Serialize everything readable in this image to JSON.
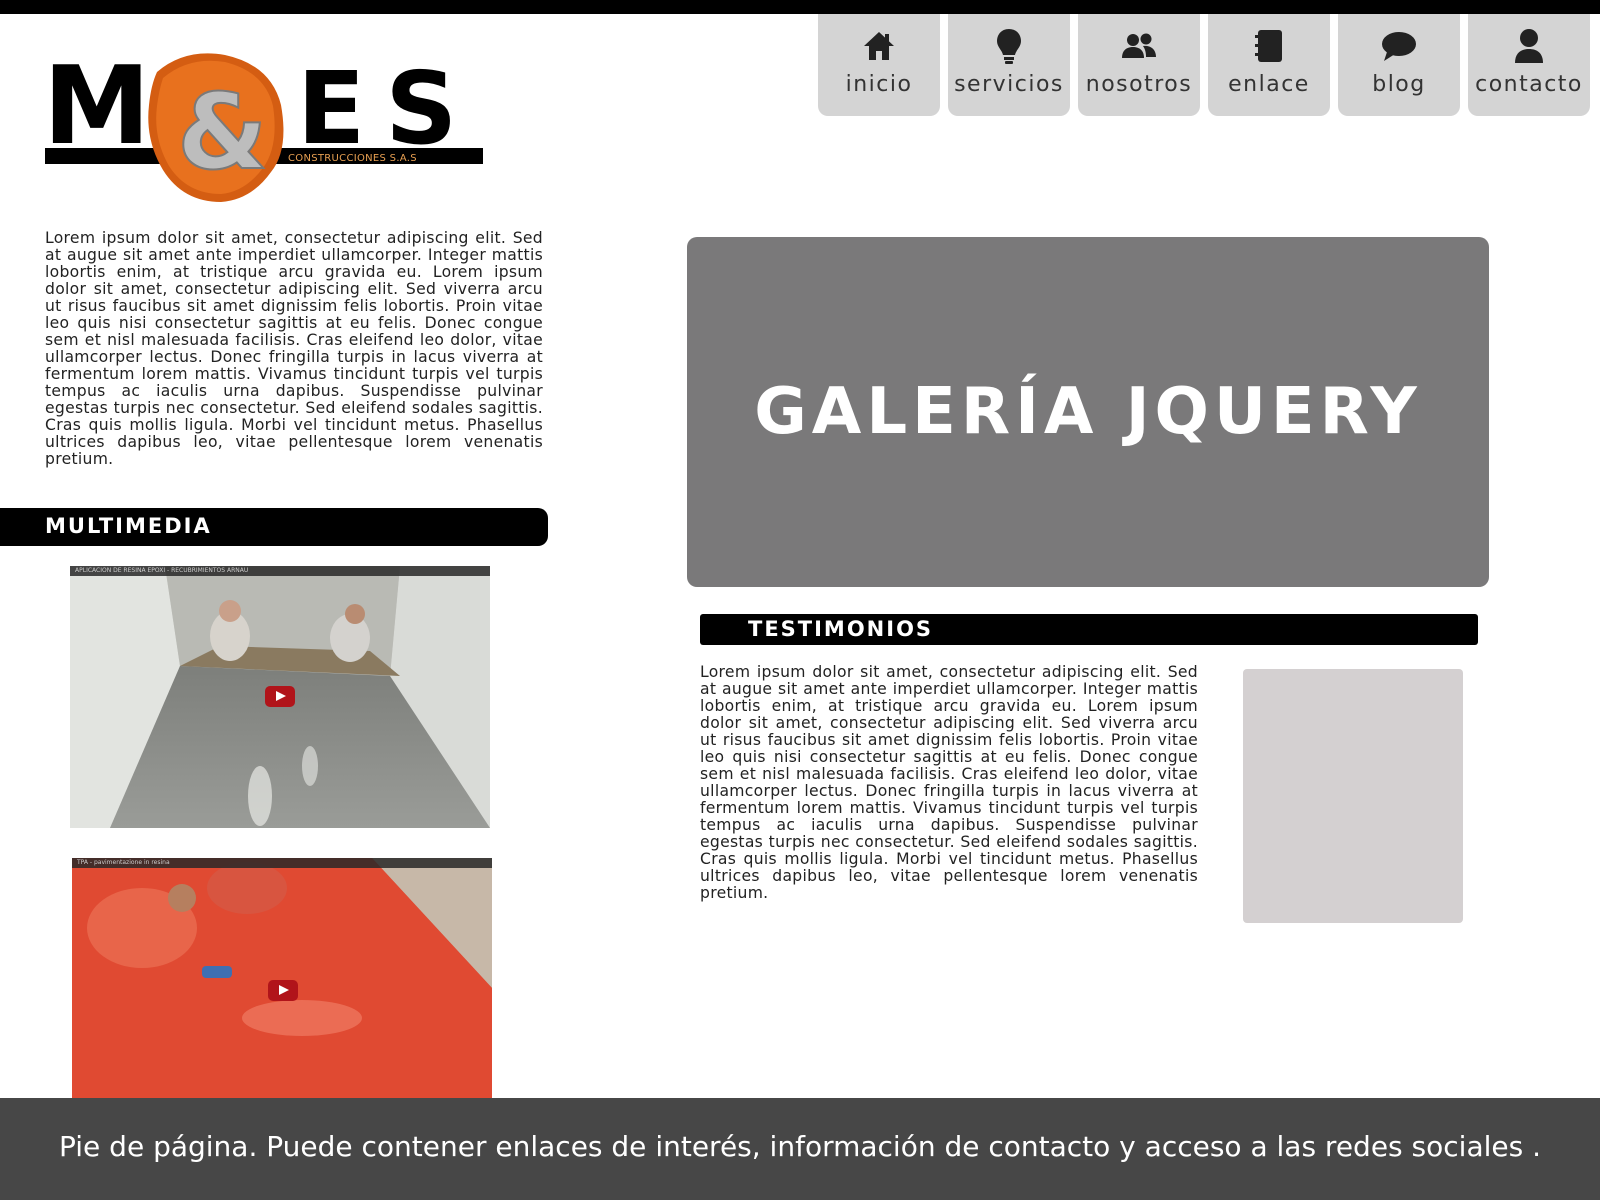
{
  "logo": {
    "letters_left": "M",
    "ampersand": "&",
    "letters_right": "ES",
    "tagline": "CONSTRUCCIONES S.A.S"
  },
  "nav": {
    "items": [
      {
        "label": "inicio",
        "icon": "home-icon"
      },
      {
        "label": "servicios",
        "icon": "lightbulb-icon"
      },
      {
        "label": "nosotros",
        "icon": "users-icon"
      },
      {
        "label": "enlace",
        "icon": "notebook-icon"
      },
      {
        "label": "blog",
        "icon": "speech-bubble-icon"
      },
      {
        "label": "contacto",
        "icon": "user-icon"
      }
    ]
  },
  "intro": {
    "text": "Lorem ipsum dolor sit amet, consectetur adipiscing elit. Sed at augue sit amet ante imperdiet ullamcorper. Integer mattis lobortis enim, at tristique arcu gravida eu. Lorem ipsum dolor sit amet, consectetur adipiscing elit. Sed viverra arcu ut risus faucibus sit amet dignissim felis lobortis. Proin vitae leo quis nisi consectetur sagittis at eu felis. Donec congue sem et nisl malesuada facilisis. Cras eleifend leo dolor, vitae ullamcorper lectus. Donec fringilla turpis in lacus viverra at fermentum lorem mattis. Vivamus tincidunt turpis vel turpis tempus ac iaculis urna dapibus. Suspendisse pulvinar egestas turpis nec consectetur. Sed eleifend sodales sagittis. Cras quis mollis ligula. Morbi vel tincidunt metus. Phasellus ultrices dapibus leo, vitae pellentesque lorem venenatis pretium."
  },
  "multimedia": {
    "title": "MULTIMEDIA",
    "videos": [
      {
        "title": "APLICACION DE RESINA EPOXI - RECUBRIMIENTOS ARNAU"
      },
      {
        "title": "TPA - pavimentazione in resina"
      }
    ]
  },
  "gallery": {
    "title": "GALERÍA JQUERY"
  },
  "testimonios": {
    "title": "TESTIMONIOS",
    "text": "Lorem ipsum dolor sit amet, consectetur adipiscing elit. Sed at augue sit amet ante imperdiet ullamcorper. Integer mattis lobortis enim, at tristique arcu gravida eu. Lorem ipsum dolor sit amet, consectetur adipiscing elit. Sed viverra arcu ut risus faucibus sit amet dignissim felis lobortis. Proin vitae leo quis nisi consectetur sagittis at eu felis. Donec congue sem et nisl malesuada facilisis. Cras eleifend leo dolor, vitae ullamcorper lectus. Donec fringilla turpis in lacus viverra at fermentum lorem mattis. Vivamus tincidunt turpis vel turpis tempus ac iaculis urna dapibus. Suspendisse pulvinar egestas turpis nec consectetur. Sed eleifend sodales sagittis. Cras quis mollis ligula. Morbi vel tincidunt metus. Phasellus ultrices dapibus leo, vitae pellentesque lorem venenatis pretium."
  },
  "footer": {
    "text": "Pie de página. Puede contener enlaces de interés, información de contacto y acceso a las redes sociales ."
  },
  "colors": {
    "gallery_bg": "#7a797a",
    "footer_bg": "#474747",
    "nav_bg": "#d4d4d4",
    "logo_orange": "#e8711e"
  }
}
